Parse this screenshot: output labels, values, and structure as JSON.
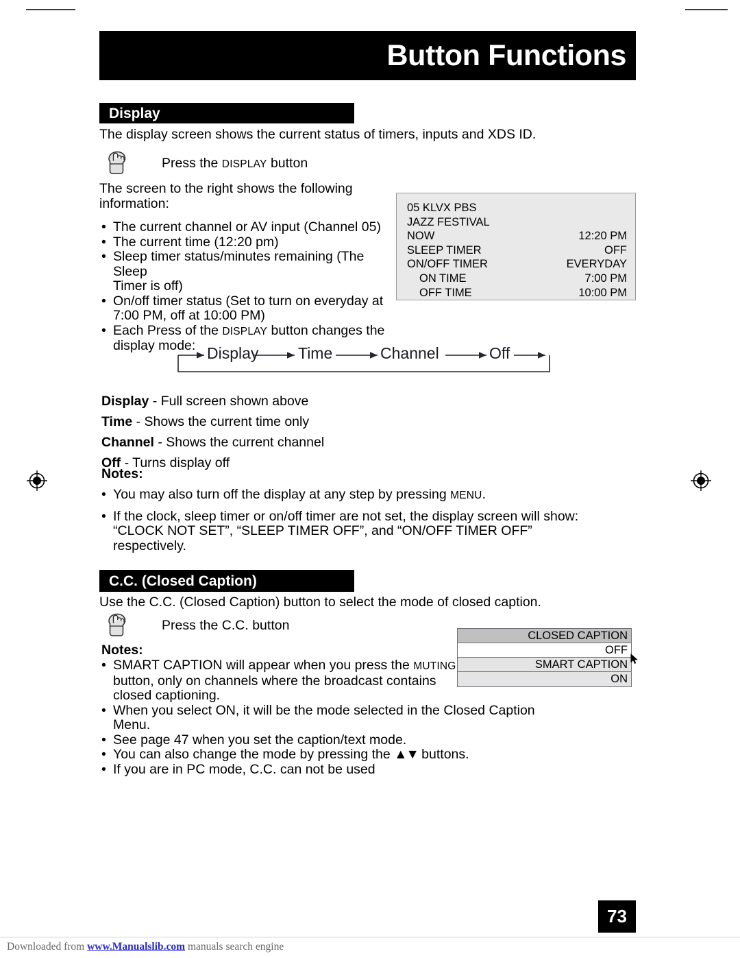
{
  "page": {
    "header_title": "Button Functions",
    "page_number": "73"
  },
  "display_section": {
    "bar_label": "Display",
    "intro": "The display screen shows the current status of timers, inputs and XDS ID.",
    "press_prefix": "Press the ",
    "press_smallcaps": "Display",
    "press_suffix": " button",
    "screen_intro": "The screen to the right shows the following\ninformation:",
    "bullets": [
      "The current channel or AV input (Channel 05)",
      "The current time (12:20 pm)",
      "Sleep timer status/minutes remaining (The Sleep\nTimer is off)",
      "On/off timer status (Set to turn on everyday at\n7:00 PM, off at 10:00 PM)"
    ],
    "last_bullet": {
      "prefix": "Each Press of the ",
      "smallcaps": "Display",
      "suffix": " button changes the\ndisplay mode:"
    },
    "definitions": [
      {
        "term": "Display",
        "desc": " - Full screen shown above"
      },
      {
        "term": "Time",
        "desc": " - Shows the current time only"
      },
      {
        "term": "Channel",
        "desc": " - Shows the current channel"
      },
      {
        "term": "Off",
        "desc": " - Turns display off"
      }
    ],
    "notes_label": "Notes:",
    "note_1": {
      "prefix": "You may also turn off the display at any step by pressing ",
      "smallcaps": "Menu",
      "suffix": "."
    },
    "note_2": "If the clock, sleep timer or on/off timer are not set, the display screen will show:\n“CLOCK NOT SET”, “SLEEP TIMER OFF”, and “ON/OFF TIMER OFF” respectively."
  },
  "tv_screen": {
    "lines": [
      {
        "label": "05  KLVX  PBS",
        "value": "",
        "indent": false
      },
      {
        "label": "JAZZ FESTIVAL",
        "value": "",
        "indent": false
      },
      {
        "label": "NOW",
        "value": "12:20 PM",
        "indent": false
      },
      {
        "label": "SLEEP TIMER",
        "value": "OFF",
        "indent": false
      },
      {
        "label": "ON/OFF TIMER",
        "value": "EVERYDAY",
        "indent": false
      },
      {
        "label": "ON TIME",
        "value": "7:00 PM",
        "indent": true
      },
      {
        "label": "OFF TIME",
        "value": "10:00 PM",
        "indent": true
      }
    ]
  },
  "flow_diagram": {
    "steps": [
      "Display",
      "Time",
      "Channel",
      "Off"
    ]
  },
  "cc_section": {
    "bar_label": "C.C. (Closed Caption)",
    "intro": "Use the C.C. (Closed Caption) button to select the mode of closed caption.",
    "press_text": "Press the C.C. button",
    "notes_label": "Notes:",
    "note_1": {
      "prefix": "SMART CAPTION will appear when you press the ",
      "smallcaps": "Muting",
      "suffix": "\nbutton, only on channels where the broadcast contains\nclosed captioning."
    },
    "notes_rest": [
      "When you select ON, it will be the mode selected in the Closed Caption Menu.",
      "See page 47 when you set the caption/text mode.",
      "If you are in PC mode, C.C. can not be used"
    ],
    "note_arrows": {
      "prefix": "You can also change the mode by pressing the ",
      "glyphs": "▲▼",
      "suffix": " buttons."
    }
  },
  "cc_menu": {
    "rows": [
      {
        "label": "CLOSED CAPTION",
        "style": "head"
      },
      {
        "label": "OFF",
        "style": "off"
      },
      {
        "label": "SMART CAPTION",
        "style": "smart"
      },
      {
        "label": "ON",
        "style": "on"
      }
    ]
  },
  "footer": {
    "prefix": "Downloaded from ",
    "link": "www.Manualslib.com",
    "suffix": " manuals search engine"
  },
  "colors": {
    "bar_black": "#000000",
    "screen_bg": "#e9e9e9",
    "menu_head": "#c0c0c0",
    "menu_row": "#e4e4e4",
    "link_blue": "#2a2ad0"
  }
}
